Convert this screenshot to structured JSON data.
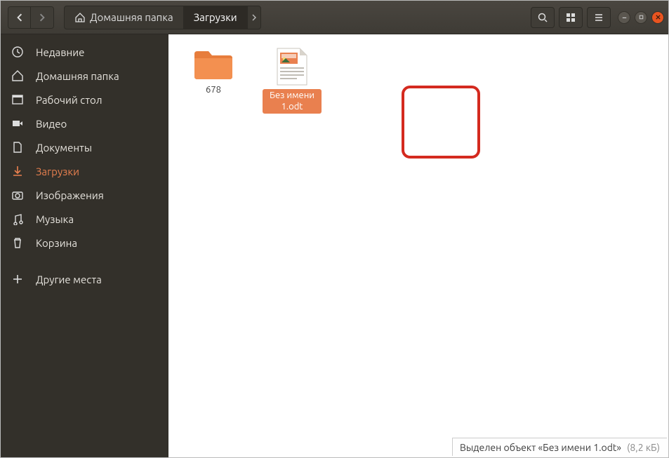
{
  "colors": {
    "accent": "#e95420",
    "sidebar_bg": "#33302a",
    "header_bg": "#3e3b35",
    "highlight_border": "#d42a1f"
  },
  "header": {
    "path": {
      "home_label": "Домашняя папка",
      "current": "Загрузки"
    }
  },
  "sidebar": {
    "items": [
      {
        "icon": "clock-icon",
        "label": "Недавние"
      },
      {
        "icon": "home-icon",
        "label": "Домашняя папка"
      },
      {
        "icon": "desktop-icon",
        "label": "Рабочий стол"
      },
      {
        "icon": "video-icon",
        "label": "Видео"
      },
      {
        "icon": "document-icon",
        "label": "Документы"
      },
      {
        "icon": "download-icon",
        "label": "Загрузки",
        "active": true
      },
      {
        "icon": "camera-icon",
        "label": "Изображения"
      },
      {
        "icon": "music-icon",
        "label": "Музыка"
      },
      {
        "icon": "trash-icon",
        "label": "Корзина"
      }
    ],
    "other_places": {
      "icon": "plus-icon",
      "label": "Другие места"
    }
  },
  "content": {
    "items": [
      {
        "type": "folder",
        "label": "678",
        "selected": false
      },
      {
        "type": "document",
        "label": "Без имени 1.odt",
        "selected": true
      }
    ]
  },
  "statusbar": {
    "text": "Выделен объект «Без имени 1.odt»",
    "size": "(8,2 кБ)"
  }
}
